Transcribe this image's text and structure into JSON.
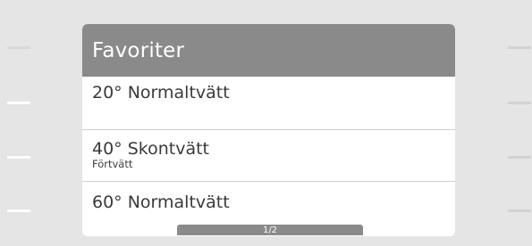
{
  "header": {
    "title": "Favoriter"
  },
  "items": [
    {
      "title": "20° Normaltvätt",
      "subtitle": ""
    },
    {
      "title": "40° Skontvätt",
      "subtitle": "Förtvätt"
    },
    {
      "title": "60° Normaltvätt",
      "subtitle": ""
    }
  ],
  "pager": {
    "label": "1/2"
  }
}
